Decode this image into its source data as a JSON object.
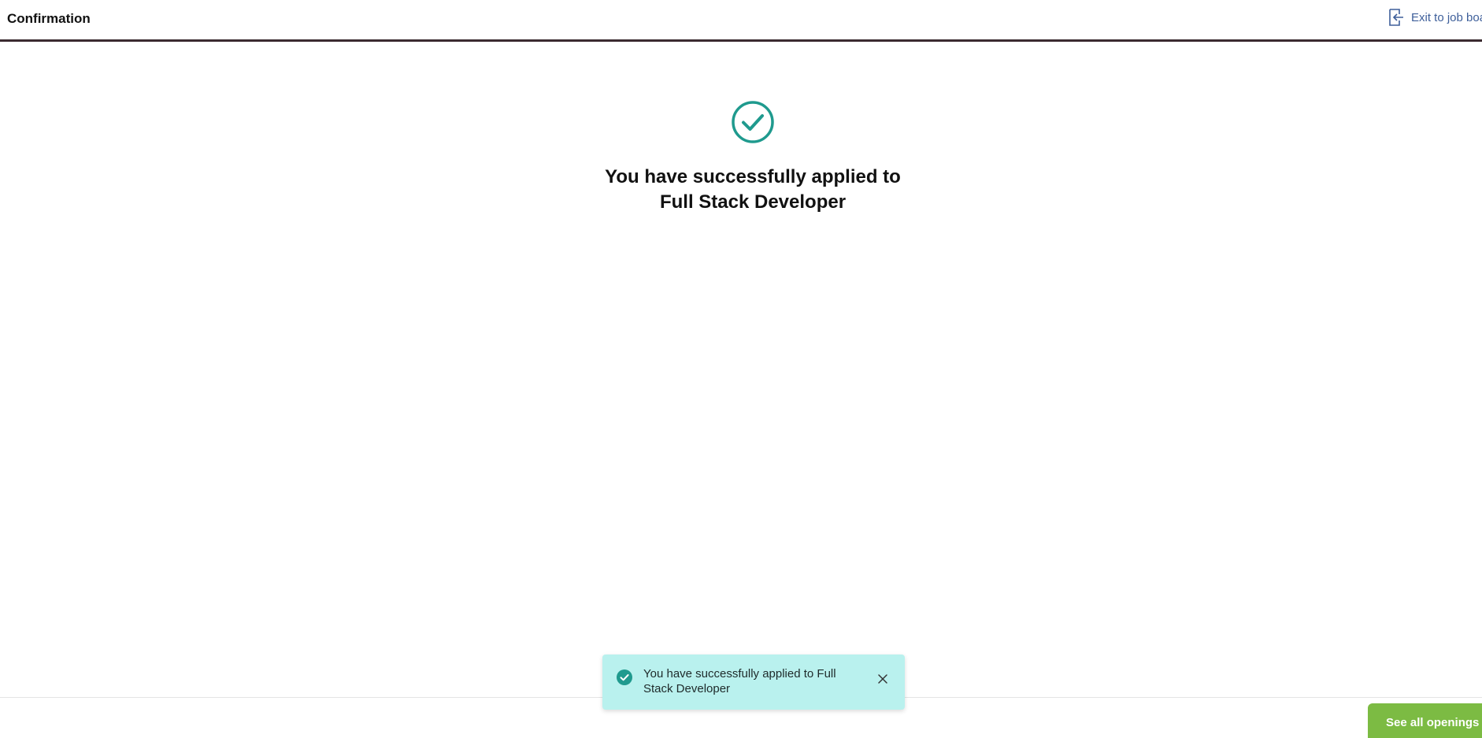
{
  "header": {
    "title": "Confirmation",
    "exit_label": "Exit to job board",
    "exit_icon": "exit-door-icon"
  },
  "confirmation": {
    "icon": "check-circle-icon",
    "message": "You have successfully applied to Full Stack Developer"
  },
  "toast": {
    "icon": "check-circle-filled-icon",
    "message": "You have successfully applied to Full Stack Developer",
    "close_icon": "close-icon"
  },
  "footer": {
    "openings_label": "See all openings"
  },
  "colors": {
    "accent_teal": "#1f9a8e",
    "link_blue": "#3e5f9a",
    "toast_bg": "#b9f1ee",
    "button_green": "#7cbb43",
    "header_rule": "#3b2a30"
  }
}
